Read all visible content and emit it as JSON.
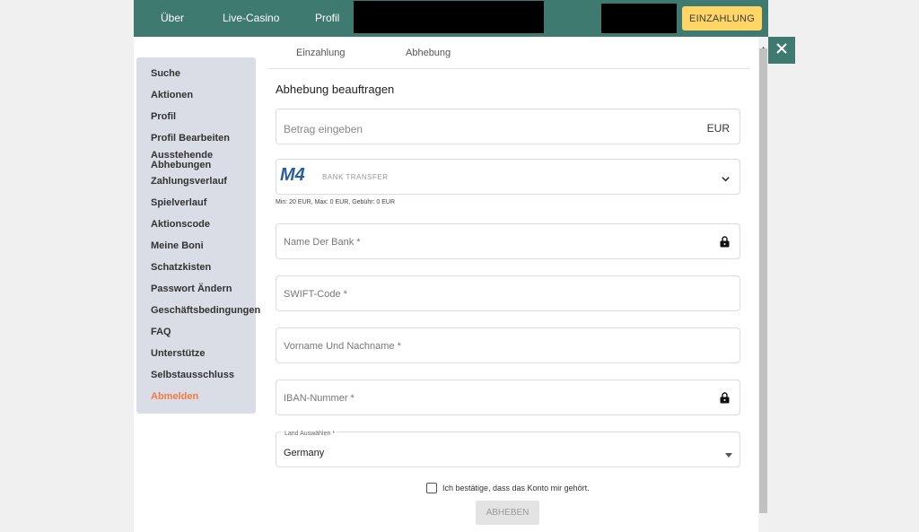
{
  "topnav": {
    "links": [
      "Über",
      "Live-Casino",
      "Profil"
    ],
    "deposit_label": "EINZAHLUNG"
  },
  "sidebar": {
    "items": [
      {
        "label": "Suche"
      },
      {
        "label": "Aktionen"
      },
      {
        "label": "Profil"
      },
      {
        "label": "Profil Bearbeiten"
      },
      {
        "label": "Ausstehende Abhebungen"
      },
      {
        "label": "Zahlungsverlauf"
      },
      {
        "label": "Spielverlauf"
      },
      {
        "label": "Aktionscode"
      },
      {
        "label": "Meine Boni"
      },
      {
        "label": "Schatzkisten"
      },
      {
        "label": "Passwort Ändern"
      },
      {
        "label": "Geschäftsbedingungen"
      },
      {
        "label": "FAQ"
      },
      {
        "label": "Unterstütze"
      },
      {
        "label": "Selbstausschluss"
      },
      {
        "label": "Abmelden"
      }
    ]
  },
  "tabs": [
    "Einzahlung",
    "Abhebung"
  ],
  "form": {
    "title": "Abhebung beauftragen",
    "amount_placeholder": "Betrag eingeben",
    "currency": "EUR",
    "method_logo": "M4",
    "method_label": "BANK TRANSFER",
    "limits": "Min: 20 EUR, Max: 0 EUR, Gebühr: 0 EUR",
    "bank_name_placeholder": "Name Der Bank *",
    "swift_placeholder": "SWIFT-Code *",
    "fullname_placeholder": "Vorname Und Nachname *",
    "iban_placeholder": "IBAN-Nummer *",
    "country_label": "Land Auswählen *",
    "country_value": "Germany",
    "confirm_text": "Ich bestätige, dass das Konto mir gehört.",
    "submit_label": "ABHEBEN"
  },
  "colors": {
    "brand": "#3e7a6f",
    "accent": "#ffd666",
    "logout": "#f47a3e",
    "sidebar_bg": "#dadce6"
  }
}
